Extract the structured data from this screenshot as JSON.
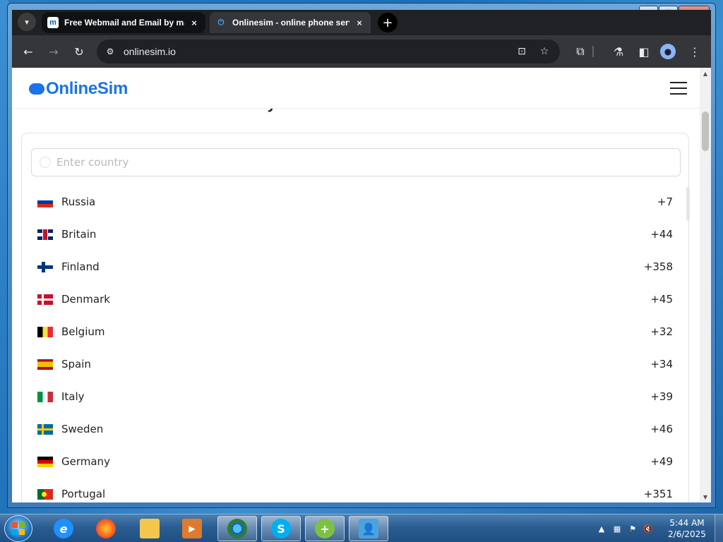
{
  "browser": {
    "tabs": [
      {
        "title": "Free Webmail and Email by ma",
        "favicon": "mail-m-icon",
        "active": false
      },
      {
        "title": "Onlinesim - online phone servi",
        "favicon": "power-icon",
        "active": true
      }
    ],
    "close_label": "×",
    "new_tab_label": "+",
    "address": "onlinesim.io"
  },
  "site": {
    "logo": "OnlineSim",
    "cut_heading": "Try our free virtual numbers",
    "search_placeholder": "Enter country",
    "countries": [
      {
        "name": "Russia",
        "code": "+7",
        "flag": "ru"
      },
      {
        "name": "Britain",
        "code": "+44",
        "flag": "gb"
      },
      {
        "name": "Finland",
        "code": "+358",
        "flag": "fi"
      },
      {
        "name": "Denmark",
        "code": "+45",
        "flag": "dk"
      },
      {
        "name": "Belgium",
        "code": "+32",
        "flag": "be"
      },
      {
        "name": "Spain",
        "code": "+34",
        "flag": "es"
      },
      {
        "name": "Italy",
        "code": "+39",
        "flag": "it"
      },
      {
        "name": "Sweden",
        "code": "+46",
        "flag": "se"
      },
      {
        "name": "Germany",
        "code": "+49",
        "flag": "de"
      },
      {
        "name": "Portugal",
        "code": "+351",
        "flag": "pt"
      }
    ]
  },
  "taskbar": {
    "apps": [
      "internet-explorer-icon",
      "firefox-icon",
      "file-explorer-icon",
      "media-player-icon",
      "chrome-icon",
      "skype-icon",
      "add-app-icon",
      "contacts-icon"
    ],
    "time": "5:44 AM",
    "date": "2/6/2025"
  },
  "colors": {
    "accent": "#1a73e8",
    "chrome_dark": "#202124"
  }
}
